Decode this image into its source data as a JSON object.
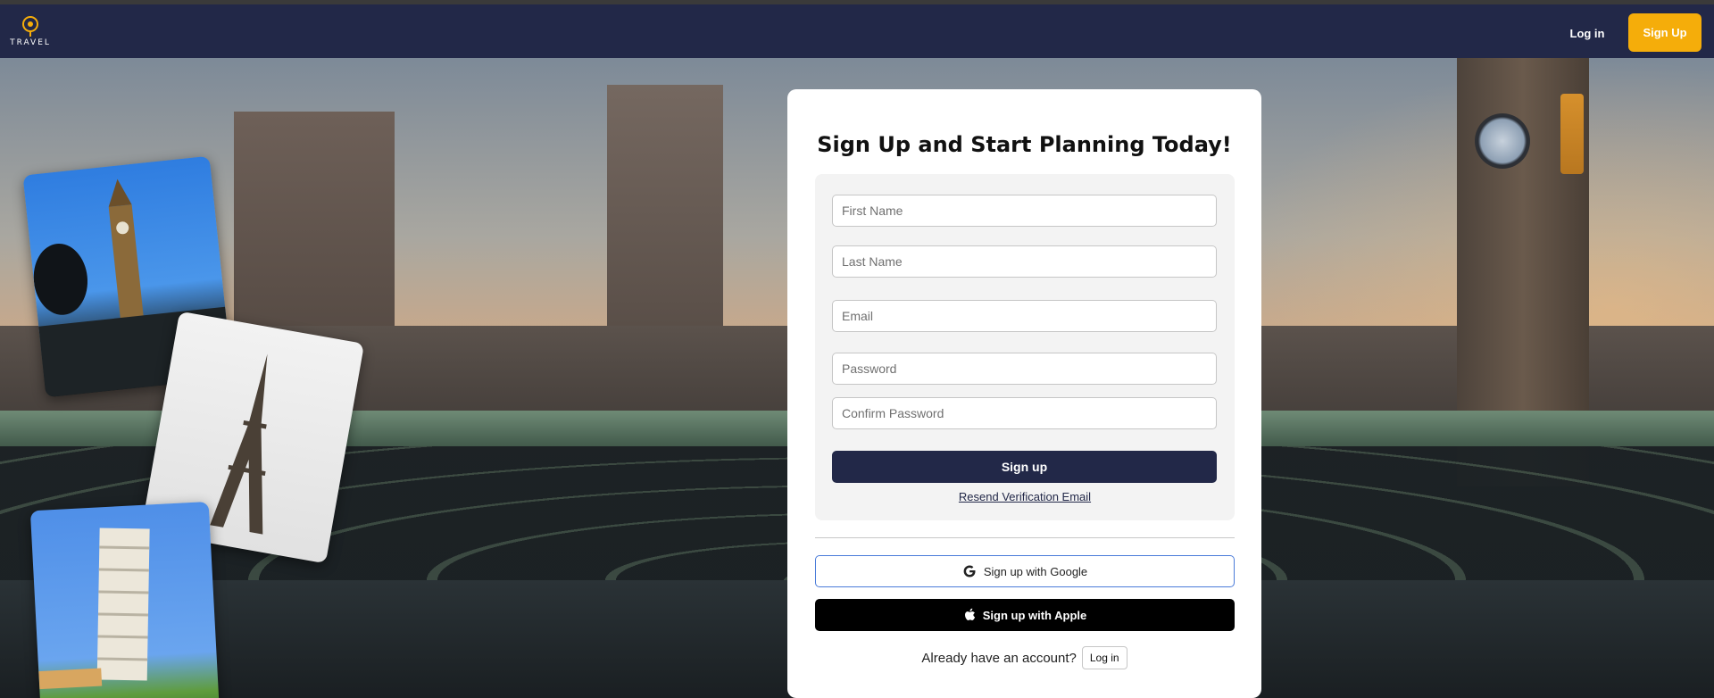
{
  "brand": {
    "logo_text": "TRAVEL",
    "accent": "#f5ad0a",
    "nav_bg": "#222848"
  },
  "nav": {
    "login_label": "Log in",
    "signup_label": "Sign Up"
  },
  "signup_form": {
    "title": "Sign Up and Start Planning Today!",
    "first_name_placeholder": "First Name",
    "last_name_placeholder": "Last Name",
    "email_placeholder": "Email",
    "password_placeholder": "Password",
    "confirm_password_placeholder": "Confirm Password",
    "submit_label": "Sign up",
    "resend_label": "Resend Verification Email"
  },
  "social": {
    "google_label": "Sign up with Google",
    "google_icon": "google-icon",
    "apple_label": "Sign up with Apple",
    "apple_icon": "apple-icon"
  },
  "footer": {
    "already_text": "Already have an account?",
    "login_label": "Log in"
  },
  "photos": [
    "big-ben-photo",
    "eiffel-tower-photo",
    "leaning-tower-of-pisa-photo"
  ]
}
